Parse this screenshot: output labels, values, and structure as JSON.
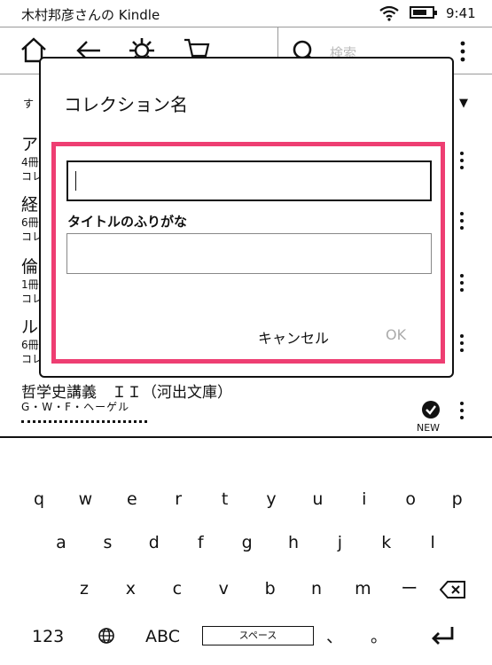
{
  "status_bar": {
    "title": "木村邦彦さんの Kindle",
    "time": "9:41",
    "battery_level": 0.75
  },
  "toolbar": {
    "icons": [
      "home-icon",
      "back-icon",
      "settings-icon",
      "cart-icon"
    ],
    "search_placeholder": "検索"
  },
  "library": {
    "sort_label": "す",
    "sort_caret": "▼",
    "collections": [
      {
        "title": "ア",
        "count": "4冊",
        "type": "コレ"
      },
      {
        "title": "経",
        "count": "6冊",
        "type": "コレ"
      },
      {
        "title": "倫",
        "count": "1冊",
        "type": "コレ"
      },
      {
        "title": "ル",
        "count": "6冊",
        "type": "コレ"
      }
    ],
    "book": {
      "title": "哲学史講義　ＩＩ（河出文庫）",
      "author": "G・W・F・ヘーゲル",
      "badge": "NEW"
    }
  },
  "dialog": {
    "title": "コレクション名",
    "name_value": "",
    "furigana_label": "タイトルのふりがな",
    "furigana_value": "",
    "cancel_label": "キャンセル",
    "ok_label": "OK",
    "highlight_color": "#ee3e72"
  },
  "keyboard": {
    "row1": [
      "q",
      "w",
      "e",
      "r",
      "t",
      "y",
      "u",
      "i",
      "o",
      "p"
    ],
    "row2": [
      "a",
      "s",
      "d",
      "f",
      "g",
      "h",
      "j",
      "k",
      "l"
    ],
    "row3": [
      "z",
      "x",
      "c",
      "v",
      "b",
      "n",
      "m",
      "ー"
    ],
    "numbers_label": "123",
    "alpha_label": "ABC",
    "space_label": "スペース",
    "comma_label": "、",
    "period_label": "。"
  }
}
